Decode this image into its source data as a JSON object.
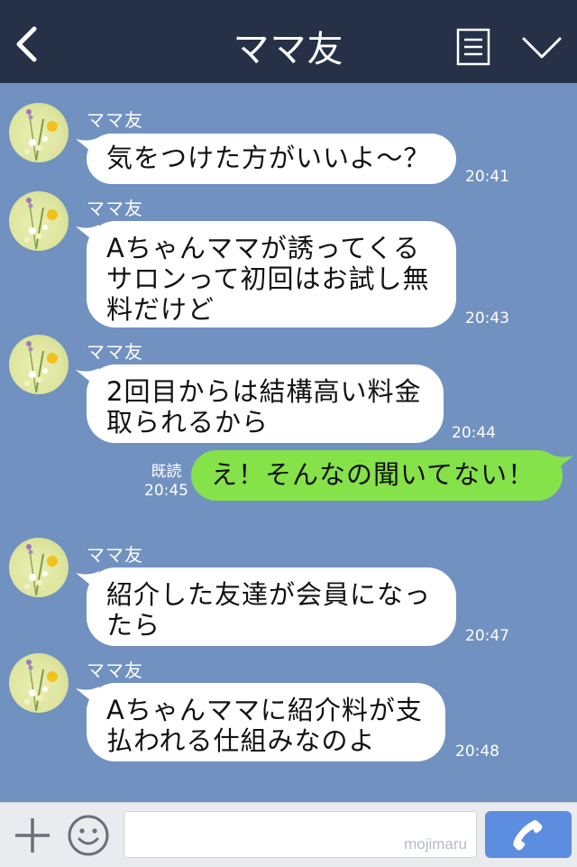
{
  "header": {
    "title": "ママ友",
    "back_icon": "chevron-left-icon",
    "menu_icon": "note-icon",
    "collapse_icon": "chevron-down-icon"
  },
  "messages": [
    {
      "sender": "ママ友",
      "lines": [
        "気をつけた方がいいよ〜？"
      ],
      "time": "20:41"
    },
    {
      "sender": "ママ友",
      "lines": [
        "Aちゃんママが誘ってくる",
        "サロンって初回はお試し無",
        "料だけど"
      ],
      "time": "20:43"
    },
    {
      "sender": "ママ友",
      "lines": [
        "2回目からは結構高い料金",
        "取られるから"
      ],
      "time": "20:44"
    },
    {
      "sender": "ママ友",
      "lines": [
        "紹介した友達が会員になっ",
        "たら"
      ],
      "time": "20:47"
    },
    {
      "sender": "ママ友",
      "lines": [
        "Aちゃんママに紹介料が支",
        "払われる仕組みなのよ"
      ],
      "time": "20:48"
    }
  ],
  "my_message": {
    "text": "え！そんなの聞いてない！",
    "read_label": "既読",
    "time": "20:45"
  },
  "input_bar": {
    "plus_icon": "plus-icon",
    "emoji_icon": "smiley-icon",
    "text_value": "",
    "watermark": "mojimaru",
    "call_icon": "phone-icon"
  },
  "colors": {
    "header_bg": "#263148",
    "chat_bg": "#7191c0",
    "my_bubble": "#85e249",
    "their_bubble": "#ffffff",
    "call_button": "#5d8ddf"
  }
}
